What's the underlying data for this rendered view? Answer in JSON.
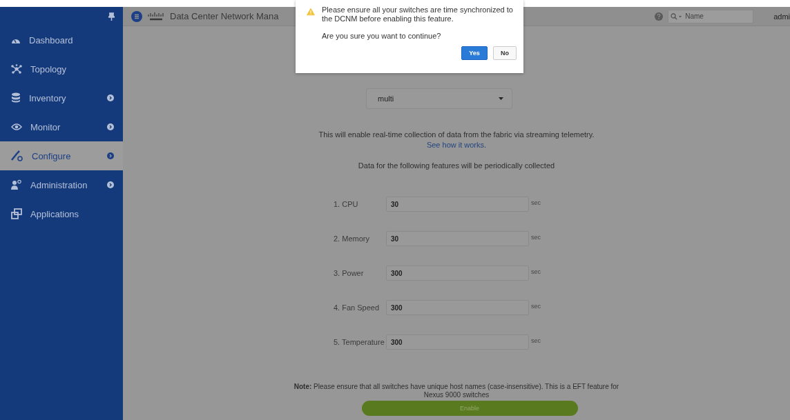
{
  "header": {
    "title": "Data Center Network Mana",
    "search": {
      "placeholder": "Name"
    },
    "user": "admi"
  },
  "sidebar": {
    "items": [
      {
        "label": "Dashboard",
        "has_arrow": false,
        "selected": false
      },
      {
        "label": "Topology",
        "has_arrow": false,
        "selected": false
      },
      {
        "label": "Inventory",
        "has_arrow": true,
        "selected": false
      },
      {
        "label": "Monitor",
        "has_arrow": true,
        "selected": false
      },
      {
        "label": "Configure",
        "has_arrow": true,
        "selected": true
      },
      {
        "label": "Administration",
        "has_arrow": true,
        "selected": false
      },
      {
        "label": "Applications",
        "has_arrow": false,
        "selected": false
      }
    ]
  },
  "fabric_select": {
    "value": "multi"
  },
  "intro": "This will enable real-time collection of data from the fabric via streaming telemetry.",
  "intro_link": "See how it works.",
  "features_heading": "Data for the following features will be periodically collected",
  "features": [
    {
      "label": "1. CPU",
      "value": "30",
      "unit": "sec"
    },
    {
      "label": "2. Memory",
      "value": "30",
      "unit": "sec"
    },
    {
      "label": "3. Power",
      "value": "300",
      "unit": "sec"
    },
    {
      "label": "4. Fan Speed",
      "value": "300",
      "unit": "sec"
    },
    {
      "label": "5. Temperature",
      "value": "300",
      "unit": "sec"
    }
  ],
  "note": "**Note:** Please ensure that all switches have unique host names (case-insensitive). This is a EFT feature for Nexus 9000 switches",
  "enable_button": "Enable",
  "dialog": {
    "message": "Please ensure all your switches are time synchronized to the DCNM before enabling this feature.",
    "question": "Are you sure you want to continue?",
    "buttons": [
      {
        "label": "Yes",
        "primary": true
      },
      {
        "label": "No",
        "primary": false
      }
    ]
  }
}
